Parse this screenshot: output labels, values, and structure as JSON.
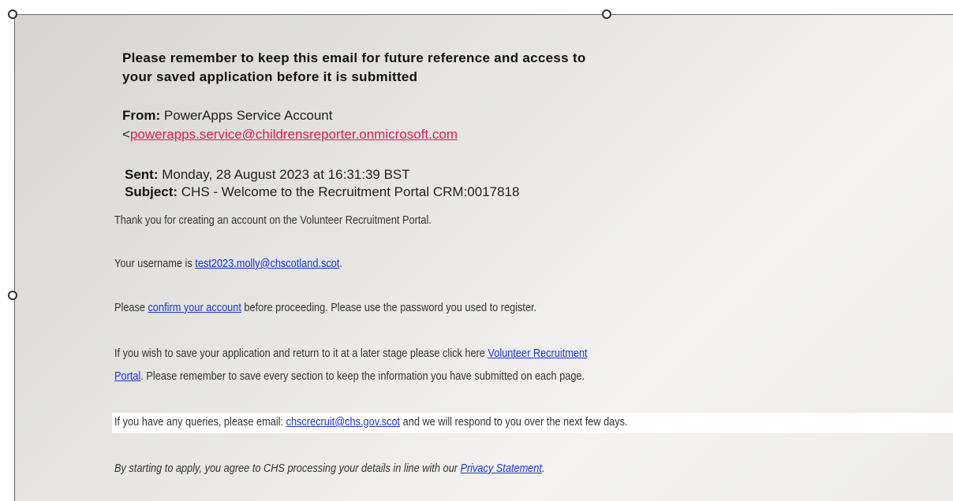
{
  "notice": {
    "line1": "Please remember to keep this email for future reference and access to",
    "line2": "your saved application before it is submitted"
  },
  "header": {
    "from_label": "From:",
    "from_name": "PowerApps Service Account",
    "from_email_prefix": "<",
    "from_email": "powerapps.service@childrensreporter.onmicrosoft.com",
    "sent_label": "Sent:",
    "sent_value": "Monday, 28 August 2023 at 16:31:39 BST",
    "subject_label": "Subject:",
    "subject_value": "CHS - Welcome to the Recruitment Portal  CRM:0017818"
  },
  "body": {
    "thanks": "Thank you for creating an account on the Volunteer Recruitment Portal.",
    "username_prefix": "Your username is ",
    "username_link": "test2023.molly@chscotland.scot",
    "username_suffix": ".",
    "confirm_prefix": "Please ",
    "confirm_link": "confirm your account",
    "confirm_suffix": " before proceeding. Please use the password you used to register.",
    "save_prefix": "If you wish to save your application and return to it at a later stage please click here ",
    "save_link_part1": "Volunteer Recruitment",
    "save_link_part2": "Portal",
    "save_suffix": ".  Please remember to save every section to keep the information you have submitted on each page.",
    "queries_prefix": "If you have any queries, please email: ",
    "queries_link": "chscrecruit@chs.gov.scot",
    "queries_suffix": " and we will respond to you over the next few days.",
    "privacy_prefix": "By starting to apply, you agree to CHS processing your details in line with our ",
    "privacy_link": "Privacy Statement",
    "privacy_suffix": "."
  },
  "colors": {
    "link": "#1a35d8",
    "pink_link": "#e01a5a",
    "background": "#e9e8e6"
  }
}
